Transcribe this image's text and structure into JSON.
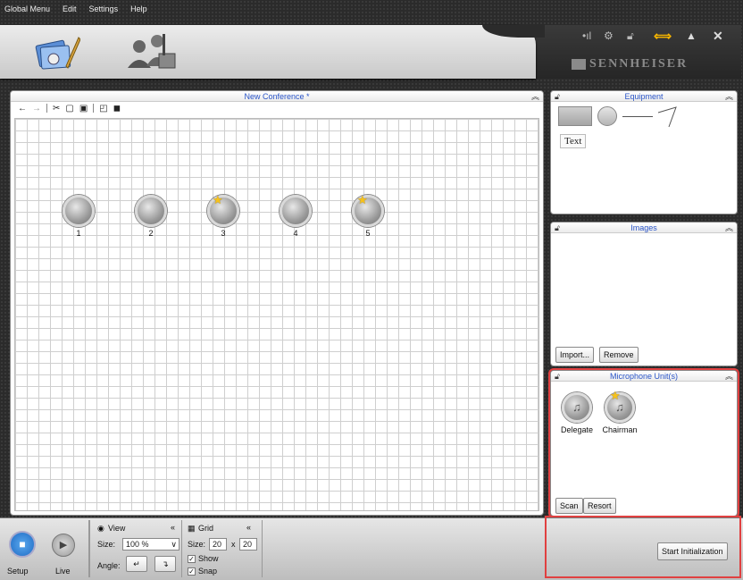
{
  "menu": [
    "Global Menu",
    "Edit",
    "Settings",
    "Help"
  ],
  "brand": "SENNHEISER",
  "canvas": {
    "title": "New Conference *",
    "mics": [
      {
        "label": "1",
        "chairman": false
      },
      {
        "label": "2",
        "chairman": false
      },
      {
        "label": "3",
        "chairman": true
      },
      {
        "label": "4",
        "chairman": false
      },
      {
        "label": "5",
        "chairman": true
      }
    ]
  },
  "equipment": {
    "title": "Equipment",
    "text_tool": "Text"
  },
  "images": {
    "title": "Images",
    "import_label": "Import...",
    "remove_label": "Remove"
  },
  "micunits": {
    "title": "Microphone Unit(s)",
    "delegate": "Delegate",
    "chairman": "Chairman",
    "scan_label": "Scan",
    "resort_label": "Resort"
  },
  "bottom": {
    "setup": "Setup",
    "live": "Live",
    "view": {
      "title": "View",
      "size_label": "Size:",
      "size_value": "100 %",
      "angle_label": "Angle:"
    },
    "grid": {
      "title": "Grid",
      "size_label": "Size:",
      "size_w": "20",
      "size_x": "x",
      "size_h": "20",
      "show": "Show",
      "snap": "Snap"
    },
    "start": "Start Initialization"
  }
}
